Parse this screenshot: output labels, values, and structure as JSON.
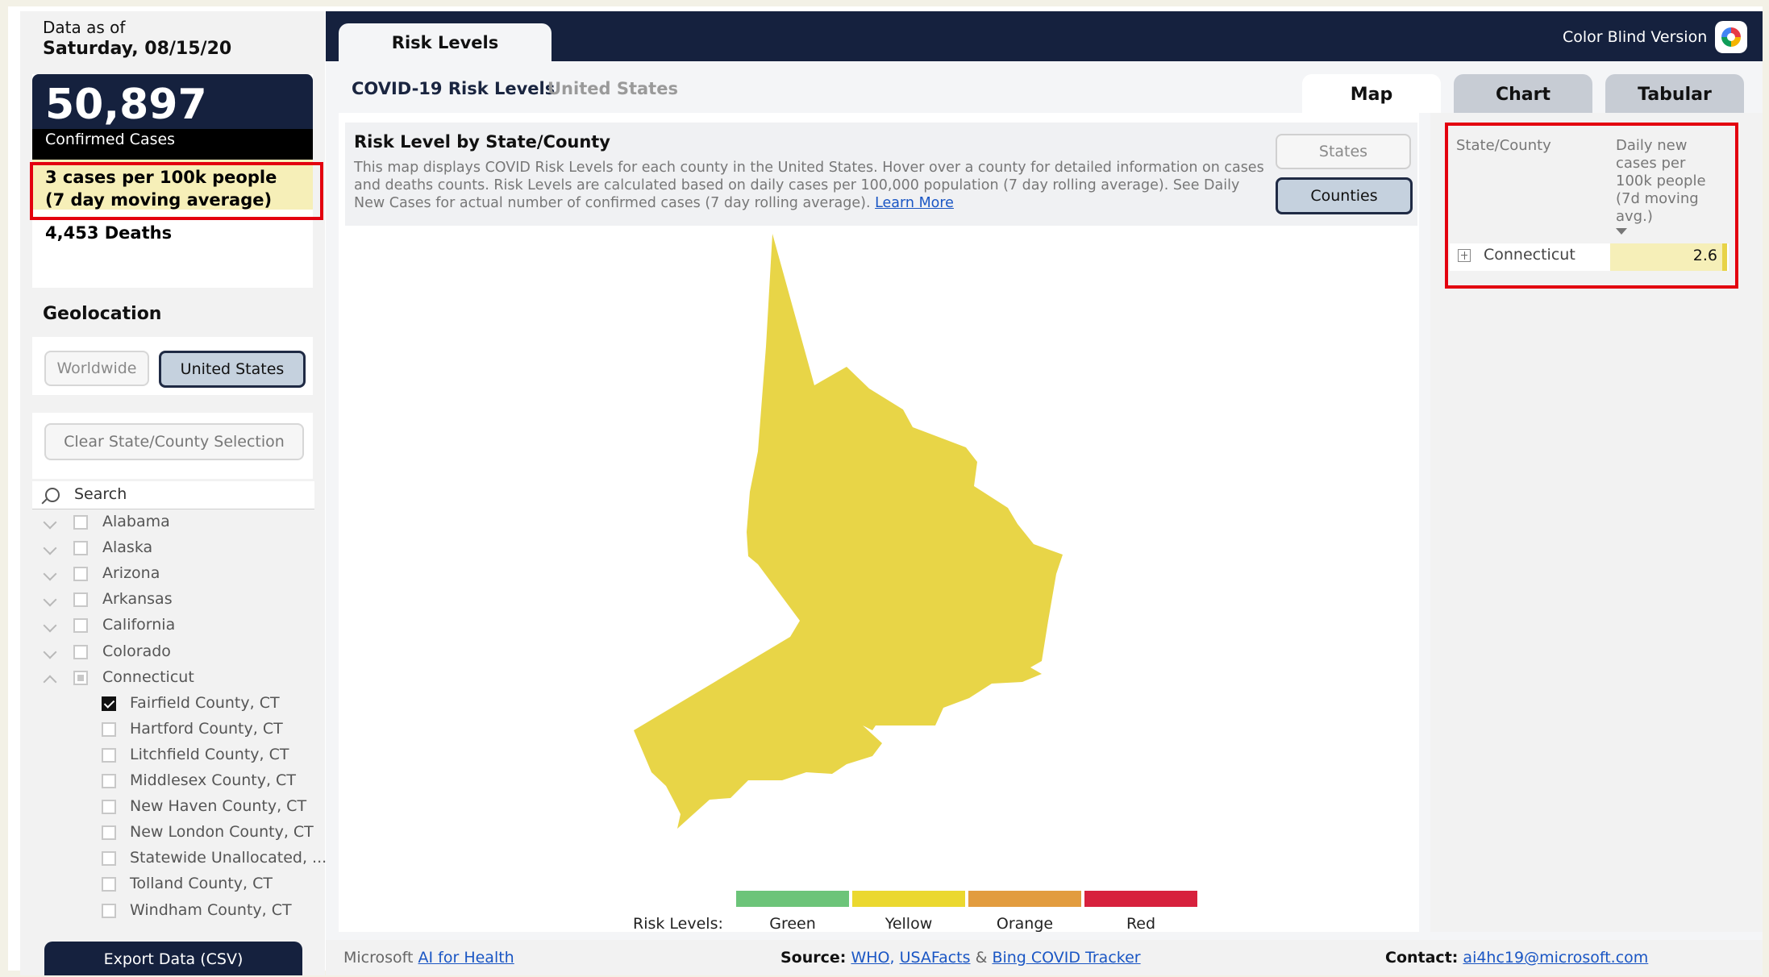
{
  "header": {
    "data_as_of_label": "Data as of",
    "data_as_of_date": "Saturday, 08/15/20",
    "main_tab": "Risk Levels",
    "color_blind_label": "Color Blind Version",
    "color_blind_icon": "color-wheel-icon"
  },
  "kpi": {
    "confirmed_value": "50,897",
    "confirmed_label": "Confirmed Cases",
    "rate_text": "3 cases per 100k people (7 day moving average)",
    "deaths_text": "4,453 Deaths"
  },
  "geolocation": {
    "title": "Geolocation",
    "options": [
      "Worldwide",
      "United States"
    ],
    "selected": "United States",
    "clear_label": "Clear State/County Selection",
    "search_placeholder": "Search"
  },
  "slicer": {
    "states": [
      {
        "label": "Alabama",
        "expanded": false,
        "state": "unchecked"
      },
      {
        "label": "Alaska",
        "expanded": false,
        "state": "unchecked"
      },
      {
        "label": "Arizona",
        "expanded": false,
        "state": "unchecked"
      },
      {
        "label": "Arkansas",
        "expanded": false,
        "state": "unchecked"
      },
      {
        "label": "California",
        "expanded": false,
        "state": "unchecked"
      },
      {
        "label": "Colorado",
        "expanded": false,
        "state": "unchecked"
      },
      {
        "label": "Connecticut",
        "expanded": true,
        "state": "partial"
      }
    ],
    "counties": [
      {
        "label": "Fairfield County, CT",
        "checked": true
      },
      {
        "label": "Hartford County, CT",
        "checked": false
      },
      {
        "label": "Litchfield County, CT",
        "checked": false
      },
      {
        "label": "Middlesex County, CT",
        "checked": false
      },
      {
        "label": "New Haven County, CT",
        "checked": false
      },
      {
        "label": "New London County, CT",
        "checked": false
      },
      {
        "label": "Statewide Unallocated, ...",
        "checked": false
      },
      {
        "label": "Tolland County, CT",
        "checked": false
      },
      {
        "label": "Windham County, CT",
        "checked": false
      }
    ],
    "export_label": "Export Data (CSV)"
  },
  "breadcrumb": {
    "title": "COVID-19 Risk Levels",
    "region": "United States"
  },
  "view_tabs": [
    "Map",
    "Chart",
    "Tabular"
  ],
  "active_view": "Map",
  "map_section": {
    "title": "Risk Level by State/County",
    "description": "This map displays COVID Risk Levels for each county in the United States. Hover over a county for detailed information on cases and deaths counts. Risk Levels are calculated based on daily cases per 100,000 population (7 day rolling average). See Daily New Cases for actual number of confirmed cases (7 day rolling average).",
    "learn_more": "Learn More",
    "states_button": "States",
    "counties_button": "Counties",
    "region_shown": "Fairfield County, CT",
    "region_color": "#e8d547"
  },
  "legend": {
    "label": "Risk Levels:",
    "levels": [
      {
        "name": "Green",
        "color": "#6cc479"
      },
      {
        "name": "Yellow",
        "color": "#ebd82f"
      },
      {
        "name": "Orange",
        "color": "#e29c3f"
      },
      {
        "name": "Red",
        "color": "#d7213d"
      }
    ]
  },
  "table": {
    "col1": "State/County",
    "col2": "Daily new cases per 100k people (7d moving avg.)",
    "rows": [
      {
        "name": "Connecticut",
        "value": "2.6"
      }
    ]
  },
  "footer": {
    "company": "Microsoft",
    "ai_link": "AI for Health",
    "source_label": "Source:",
    "source_who": "WHO",
    "source_usafacts": "USAFacts",
    "source_amp": "&",
    "source_bing": "Bing COVID Tracker",
    "contact_label": "Contact:",
    "contact_email": "ai4hc19@microsoft.com"
  },
  "colors": {
    "navy": "#15213e",
    "highlight": "#e3000f",
    "link": "#1a56c4"
  }
}
